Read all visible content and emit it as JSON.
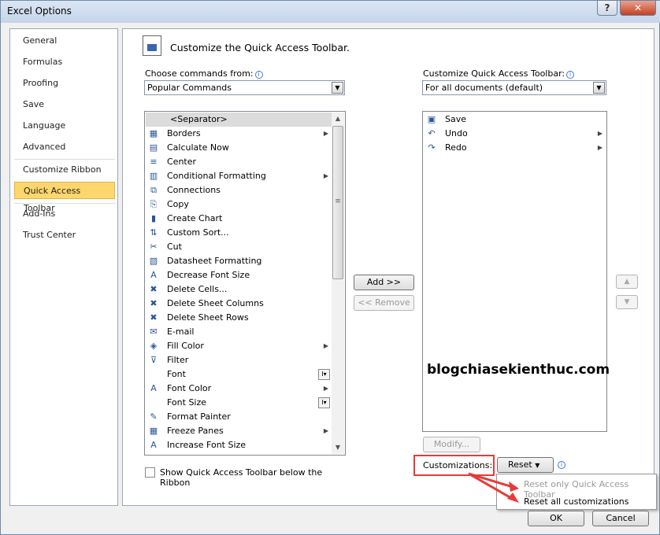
{
  "window": {
    "title": "Excel Options",
    "help_glyph": "?",
    "close_glyph": "✕"
  },
  "nav": {
    "items": [
      {
        "label": "General"
      },
      {
        "label": "Formulas"
      },
      {
        "label": "Proofing"
      },
      {
        "label": "Save"
      },
      {
        "label": "Language"
      },
      {
        "label": "Advanced"
      },
      {
        "label": "Customize Ribbon"
      },
      {
        "label": "Quick Access Toolbar",
        "selected": true
      },
      {
        "label": "Add-Ins"
      },
      {
        "label": "Trust Center"
      }
    ]
  },
  "header": {
    "title": "Customize the Quick Access Toolbar."
  },
  "left": {
    "choose_label": "Choose commands from:",
    "choose_value": "Popular Commands",
    "commands": [
      {
        "label": "<Separator>",
        "icon": "separator",
        "selected": true
      },
      {
        "label": "Borders",
        "icon": "borders-icon",
        "submenu": true
      },
      {
        "label": "Calculate Now",
        "icon": "calculator-icon"
      },
      {
        "label": "Center",
        "icon": "align-center-icon"
      },
      {
        "label": "Conditional Formatting",
        "icon": "conditional-formatting-icon",
        "submenu": true
      },
      {
        "label": "Connections",
        "icon": "connections-icon"
      },
      {
        "label": "Copy",
        "icon": "copy-icon"
      },
      {
        "label": "Create Chart",
        "icon": "chart-icon"
      },
      {
        "label": "Custom Sort...",
        "icon": "sort-icon"
      },
      {
        "label": "Cut",
        "icon": "scissors-icon"
      },
      {
        "label": "Datasheet Formatting",
        "icon": "datasheet-icon"
      },
      {
        "label": "Decrease Font Size",
        "icon": "decrease-font-icon"
      },
      {
        "label": "Delete Cells...",
        "icon": "delete-cells-icon"
      },
      {
        "label": "Delete Sheet Columns",
        "icon": "delete-columns-icon"
      },
      {
        "label": "Delete Sheet Rows",
        "icon": "delete-rows-icon"
      },
      {
        "label": "E-mail",
        "icon": "email-icon"
      },
      {
        "label": "Fill Color",
        "icon": "fill-color-icon",
        "submenu": true
      },
      {
        "label": "Filter",
        "icon": "filter-icon"
      },
      {
        "label": "Font",
        "icon": "",
        "combo": true
      },
      {
        "label": "Font Color",
        "icon": "font-color-icon",
        "submenu": true
      },
      {
        "label": "Font Size",
        "icon": "",
        "combo": true
      },
      {
        "label": "Format Painter",
        "icon": "format-painter-icon"
      },
      {
        "label": "Freeze Panes",
        "icon": "freeze-panes-icon",
        "submenu": true
      },
      {
        "label": "Increase Font Size",
        "icon": "increase-font-icon"
      }
    ],
    "show_below_label_1": "Show Quick Access Toolbar below the",
    "show_below_label_2": "Ribbon"
  },
  "middle": {
    "add_label": "Add >>",
    "remove_label": "<< Remove"
  },
  "right": {
    "customize_label": "Customize Quick Access Toolbar:",
    "scope_value": "For all documents (default)",
    "items": [
      {
        "label": "Save",
        "icon": "save-icon"
      },
      {
        "label": "Undo",
        "icon": "undo-icon",
        "submenu": true
      },
      {
        "label": "Redo",
        "icon": "redo-icon",
        "submenu": true
      }
    ],
    "modify_label": "Modify...",
    "customizations_label": "Customizations:",
    "reset_label": "Reset",
    "reset_menu": [
      {
        "label": "Reset only Quick Access Toolbar",
        "disabled": true
      },
      {
        "label": "Reset all customizations",
        "disabled": false
      }
    ]
  },
  "watermark": "blogchiasekienthuc.com",
  "footer": {
    "ok_label": "OK",
    "cancel_label": "Cancel"
  },
  "colors": {
    "selected_nav": "#fdd66e",
    "highlight_box": "#e83a3a",
    "accent": "#3d7bd1"
  }
}
